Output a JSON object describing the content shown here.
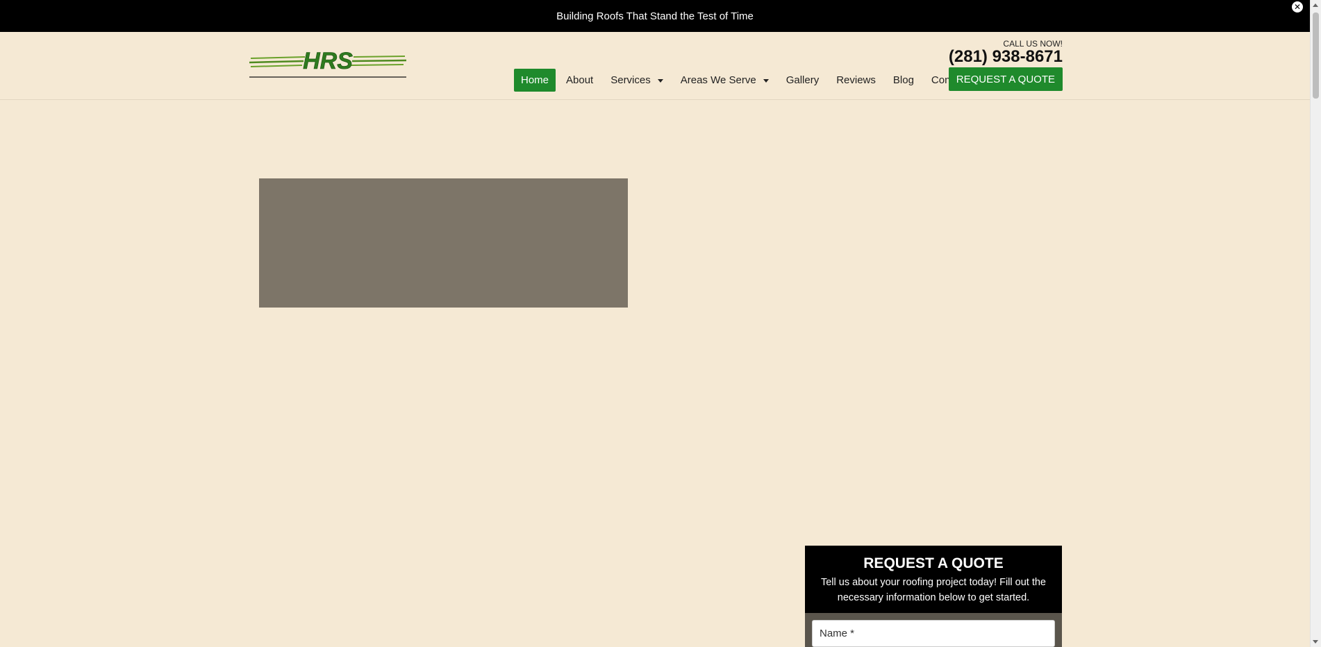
{
  "announcement": {
    "text": "Building Roofs That Stand the Test of Time",
    "close_icon": "close-icon"
  },
  "header": {
    "logo_text": "HRS",
    "call_label": "CALL US NOW!",
    "phone": "(281) 938-8671",
    "cta_label": "REQUEST A QUOTE"
  },
  "nav": {
    "items": [
      {
        "label": "Home",
        "active": true
      },
      {
        "label": "About"
      },
      {
        "label": "Services",
        "dropdown": true
      },
      {
        "label": "Areas We Serve",
        "dropdown": true
      },
      {
        "label": "Gallery"
      },
      {
        "label": "Reviews"
      },
      {
        "label": "Blog"
      },
      {
        "label": "Contact"
      }
    ]
  },
  "quote_form": {
    "title": "REQUEST A QUOTE",
    "description": "Tell us about your roofing project today! Fill out the necessary information below to get started.",
    "name_placeholder": "Name *"
  },
  "colors": {
    "background": "#f5e9d4",
    "brand_green": "#1f8a2c",
    "top_bar": "#000000",
    "hero_box": "#7d7568"
  }
}
